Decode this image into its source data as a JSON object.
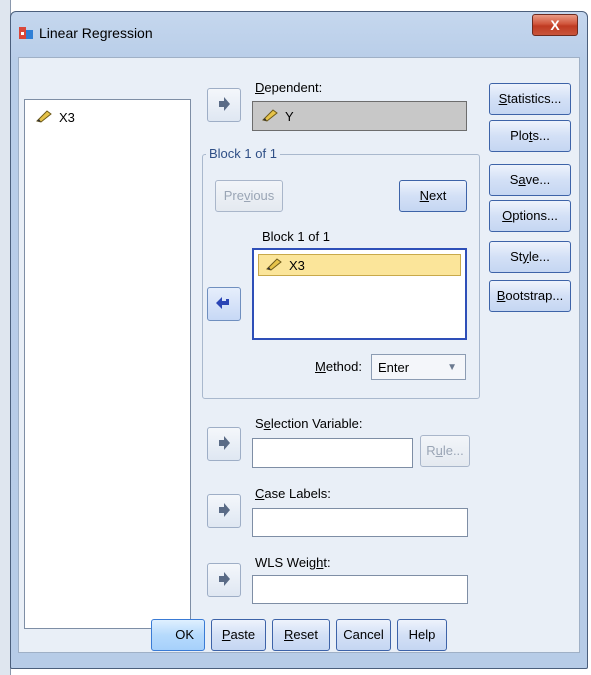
{
  "window": {
    "title": "Linear Regression",
    "close_label": "X"
  },
  "variable_list": {
    "items": [
      {
        "label": "X3",
        "icon": "ruler-pencil-icon"
      }
    ]
  },
  "dependent": {
    "label": "Dependent:",
    "value": "Y",
    "icon": "ruler-pencil-icon"
  },
  "block": {
    "group_label": "Block 1 of 1",
    "previous_label": "Previous",
    "next_label": "Next",
    "list_title": "Block 1 of 1",
    "items": [
      {
        "label": "X3",
        "icon": "ruler-pencil-icon"
      }
    ],
    "method_label": "Method:",
    "method_value": "Enter"
  },
  "selection_variable": {
    "label": "Selection Variable:",
    "value": "",
    "rule_label": "Rule..."
  },
  "case_labels": {
    "label": "Case Labels:",
    "value": ""
  },
  "wls_weight": {
    "label": "WLS Weight:",
    "value": ""
  },
  "side_buttons": [
    "Statistics...",
    "Plots...",
    "Save...",
    "Options...",
    "Style...",
    "Bootstrap..."
  ],
  "bottom_buttons": [
    "OK",
    "Paste",
    "Reset",
    "Cancel",
    "Help"
  ],
  "colors": {
    "title_gradient": "#b8cde8",
    "close_button": "#c8553b",
    "selected_item": "#fbe59a",
    "primary_border": "#3d63a8"
  }
}
